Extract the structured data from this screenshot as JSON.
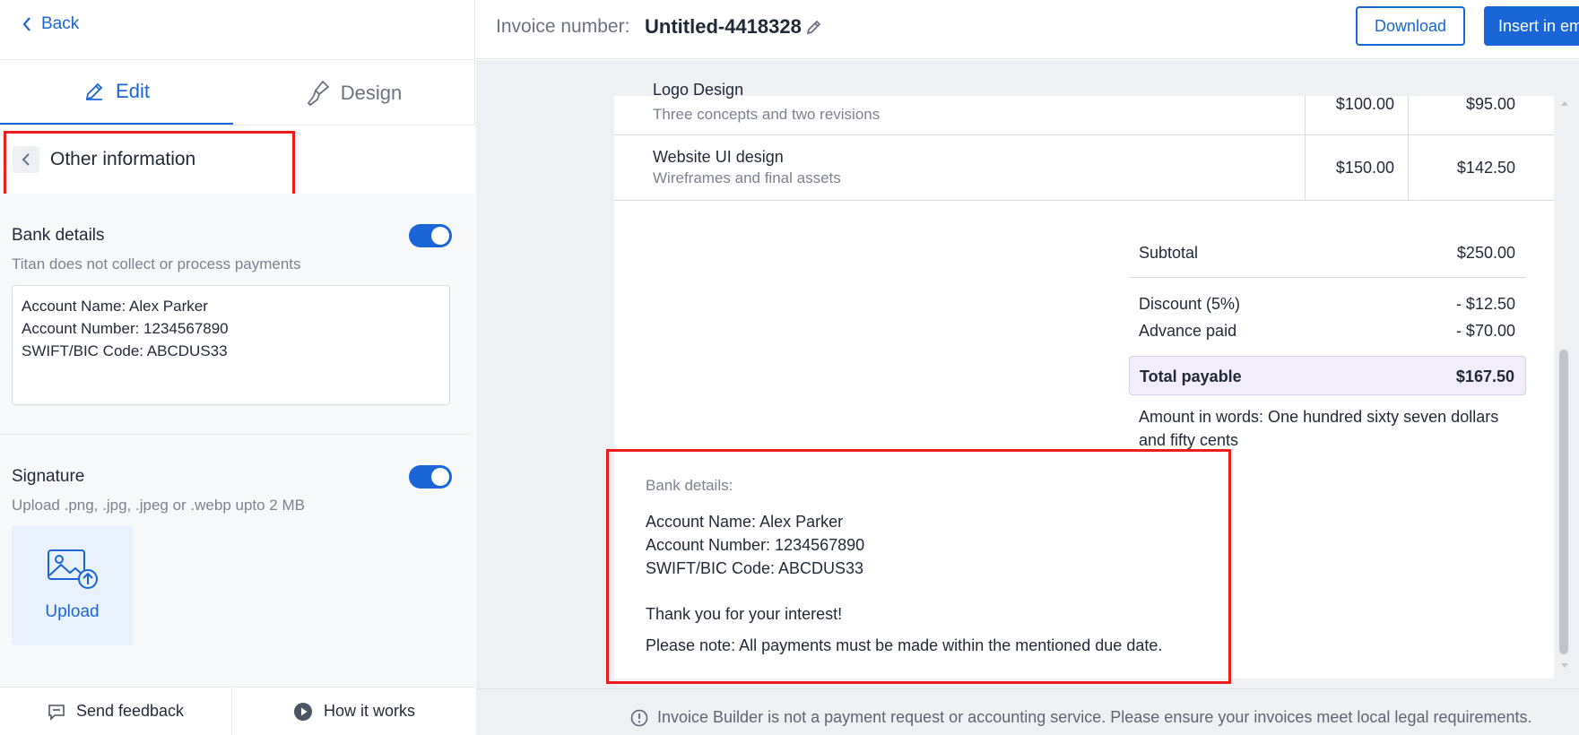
{
  "left_panel": {
    "back_label": "Back",
    "tabs": [
      {
        "label": "Edit"
      },
      {
        "label": "Design"
      }
    ],
    "section_title": "Other information",
    "bank": {
      "title": "Bank details",
      "subtitle": "Titan does not collect or process payments",
      "enabled": true,
      "lines": [
        "Account Name: Alex Parker",
        "Account Number: 1234567890",
        "SWIFT/BIC Code: ABCDUS33"
      ]
    },
    "signature": {
      "title": "Signature",
      "subtitle": "Upload .png, .jpg, .jpeg or .webp upto 2 MB",
      "enabled": true,
      "upload_label": "Upload"
    },
    "footer": {
      "send_feedback": "Send feedback",
      "how_it_works": "How it works"
    }
  },
  "header": {
    "invoice_label": "Invoice number:",
    "invoice_number": "Untitled-4418328",
    "download_label": "Download",
    "insert_label": "Insert in email"
  },
  "invoice": {
    "items": [
      {
        "title": "Logo Design",
        "desc": "Three concepts and two revisions",
        "rate": "$100.00",
        "amount": "$95.00"
      },
      {
        "title": "Website UI design",
        "desc": "Wireframes and final assets",
        "rate": "$150.00",
        "amount": "$142.50"
      }
    ],
    "subtotal_label": "Subtotal",
    "subtotal": "$250.00",
    "discount_label": "Discount (5%)",
    "discount": "- $12.50",
    "advance_label": "Advance paid",
    "advance": "- $70.00",
    "total_label": "Total payable",
    "total": "$167.50",
    "amount_words_line1": "Amount in words: One hundred sixty seven dollars",
    "amount_words_line2": "and fifty cents",
    "bank_heading": "Bank details:",
    "bank_lines": [
      "Account Name: Alex Parker",
      "Account Number: 1234567890",
      "SWIFT/BIC Code: ABCDUS33"
    ],
    "thanks": "Thank you for your interest!",
    "note": "Please note: All payments must be made within the mentioned due date."
  },
  "disclaimer": "Invoice Builder is not a payment request or accounting service. Please ensure your invoices meet local legal requirements.",
  "colors": {
    "accent": "#1a66d9",
    "highlight": "#ee1c1c",
    "total_bg": "#f2ecfb"
  }
}
